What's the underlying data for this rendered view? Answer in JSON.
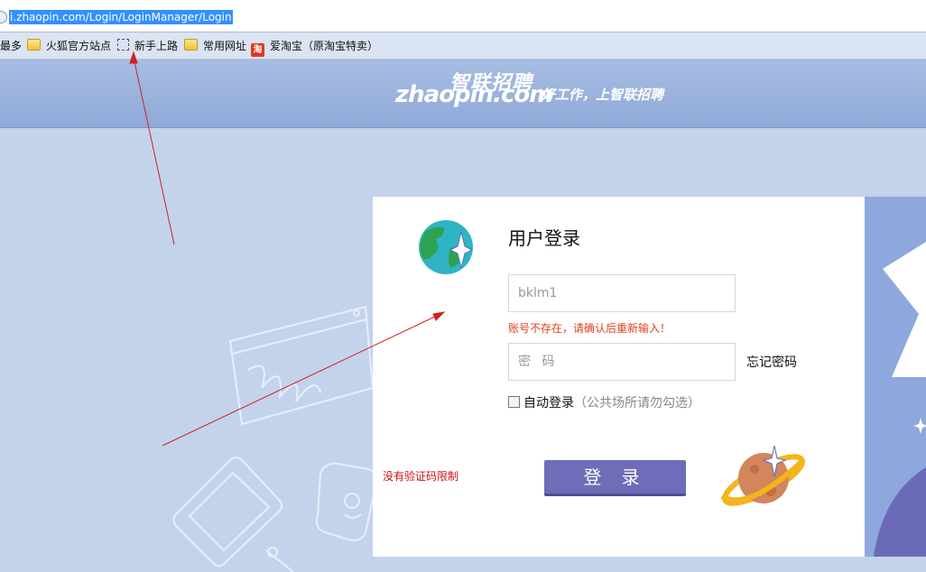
{
  "browser": {
    "url": "i.zhaopin.com/Login/LoginManager/Login",
    "bookmarks": [
      {
        "icon": "none",
        "label": "最多"
      },
      {
        "icon": "folder-icon",
        "label": "火狐官方站点"
      },
      {
        "icon": "dashed-box-icon",
        "label": "新手上路"
      },
      {
        "icon": "folder-icon",
        "label": "常用网址"
      },
      {
        "icon": "taobao-icon",
        "label": "爱淘宝（原淘宝特卖）"
      }
    ],
    "taobao_glyph": "淘"
  },
  "header": {
    "logo_cn": "智联招聘",
    "logo_en": "zhaopin.com",
    "slogan": "好工作，上智联招聘"
  },
  "login": {
    "title": "用户登录",
    "username_value": "bklm1",
    "error_text": "账号不存在，请确认后重新输入！",
    "password_placeholder": "密 码",
    "forgot_label": "忘记密码",
    "auto_login_label": "自动登录",
    "auto_login_hint": "（公共场所请勿勾选）",
    "auto_login_checked": false,
    "submit_label": "登 录"
  },
  "annotation": {
    "note": "没有验证码限制",
    "color": "#cc1111"
  },
  "colors": {
    "page_bg": "#c3d3ec",
    "header_bg": "#9ab2de",
    "button": "#6f6cb8",
    "error": "#e0401c"
  }
}
